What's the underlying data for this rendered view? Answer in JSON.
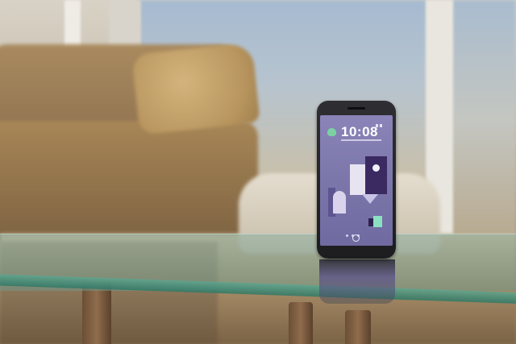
{
  "scene": {
    "description_kind": "photo",
    "phone": {
      "clock_time": "10:08",
      "colors": {
        "screen": "#7d78ab",
        "accent_green": "#8be0c2",
        "accent_dark": "#3b2a62"
      },
      "icons": [
        "weather-icon",
        "home-icon"
      ]
    }
  }
}
